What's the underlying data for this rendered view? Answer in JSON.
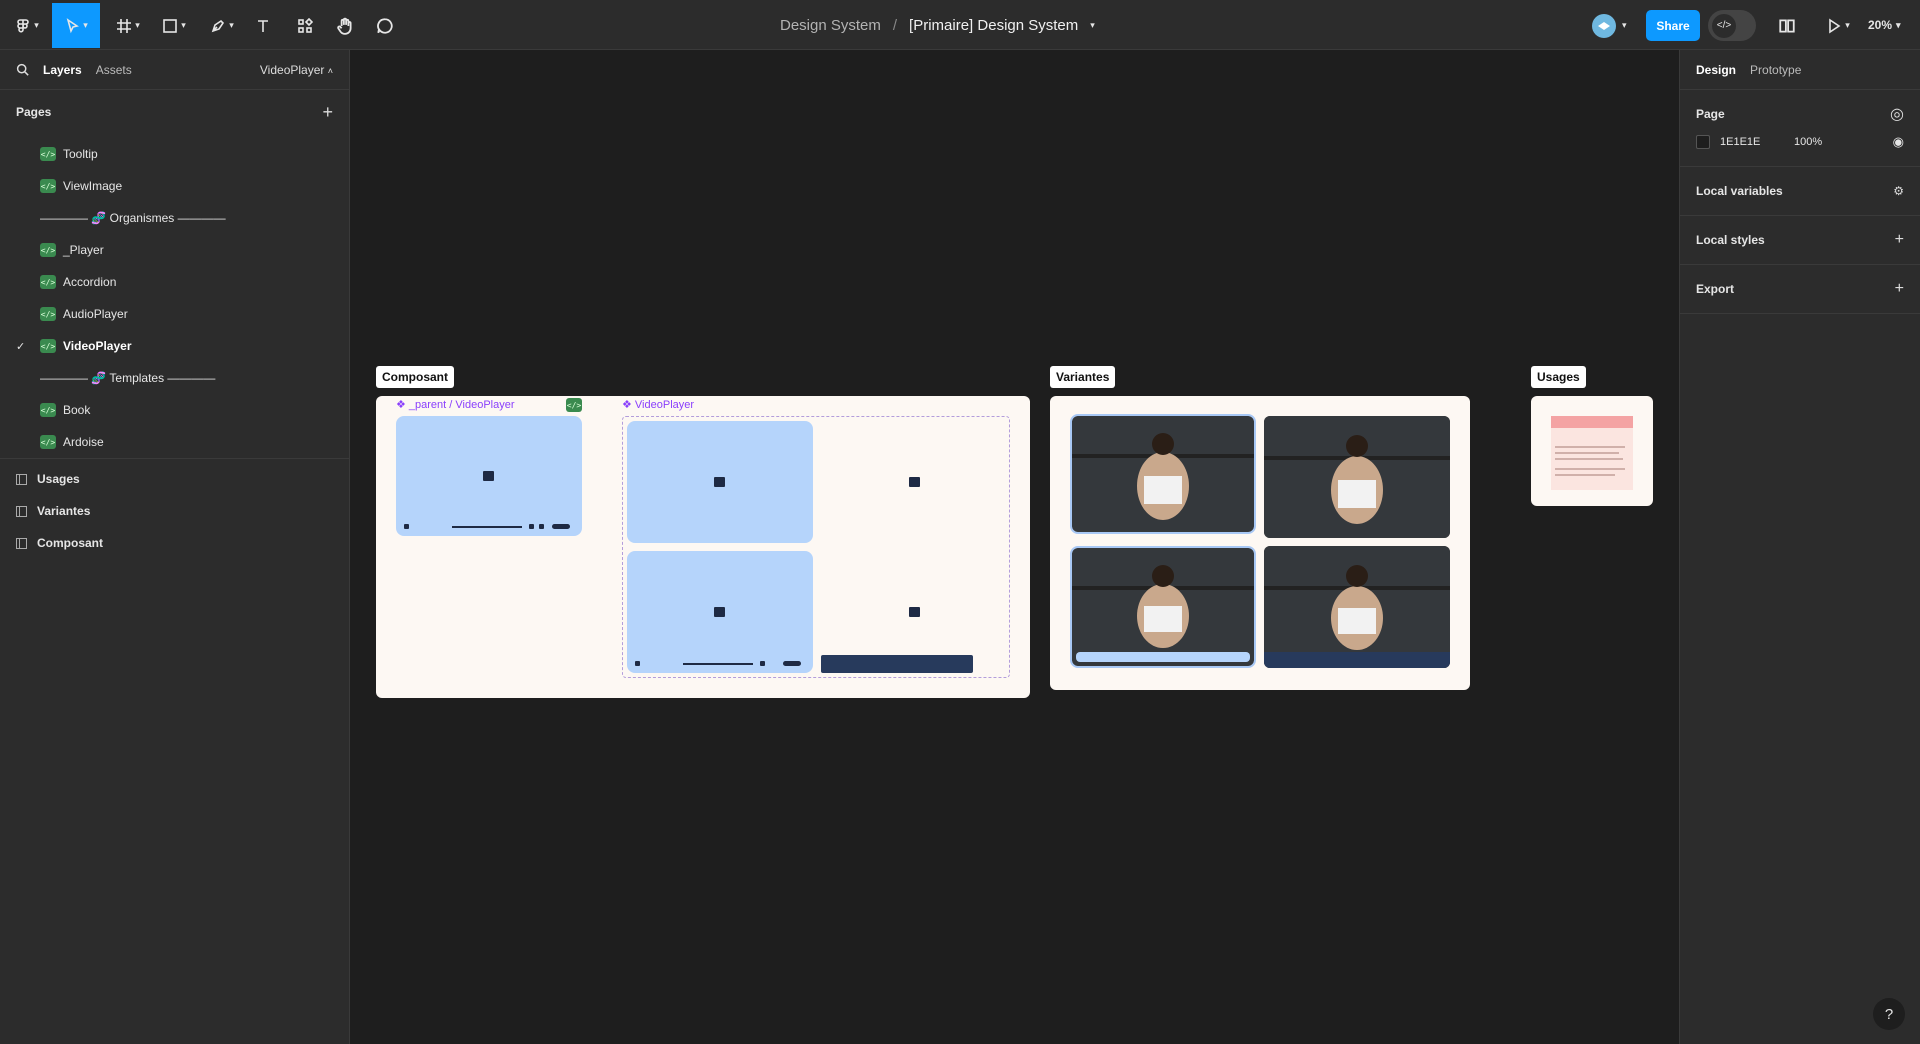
{
  "toolbar": {
    "breadcrumb": "Design System",
    "separator": "/",
    "file_title": "[Primaire] Design System",
    "share_label": "Share",
    "zoom": "20%"
  },
  "left_panel": {
    "tab_layers": "Layers",
    "tab_assets": "Assets",
    "current_page": "VideoPlayer",
    "pages_heading": "Pages",
    "pages": [
      {
        "label": "Tooltip"
      },
      {
        "label": "ViewImage"
      },
      {
        "label": "———— 🧬 Organismes ————"
      },
      {
        "label": "_Player"
      },
      {
        "label": "Accordion"
      },
      {
        "label": "AudioPlayer"
      },
      {
        "label": "VideoPlayer"
      },
      {
        "label": "———— 🧬 Templates ————"
      },
      {
        "label": "Book"
      },
      {
        "label": "Ardoise"
      }
    ],
    "layers": [
      {
        "label": "Usages"
      },
      {
        "label": "Variantes"
      },
      {
        "label": "Composant"
      }
    ]
  },
  "canvas": {
    "frames": {
      "composant": "Composant",
      "variantes": "Variantes",
      "usages": "Usages"
    },
    "composant_parent_title": "❖ _parent / VideoPlayer",
    "composant_set_title": "❖ VideoPlayer"
  },
  "right_panel": {
    "tab_design": "Design",
    "tab_prototype": "Prototype",
    "page_heading": "Page",
    "page_fill_hex": "1E1E1E",
    "page_fill_opacity": "100%",
    "local_variables": "Local variables",
    "local_styles": "Local styles",
    "export": "Export"
  },
  "colors": {
    "accent": "#0d99ff",
    "canvas": "#1e1e1e",
    "panel": "#2c2c2c",
    "component_purple": "#8a3ffc",
    "player_blue": "#b5d4fb"
  }
}
